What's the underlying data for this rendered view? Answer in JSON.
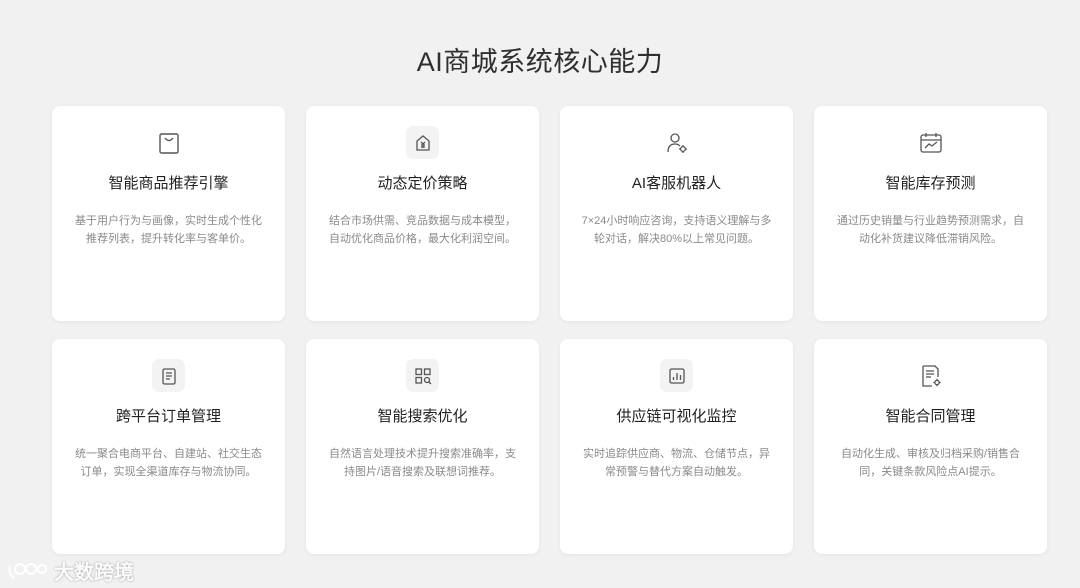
{
  "page": {
    "title": "AI商城系统核心能力"
  },
  "cards": [
    {
      "title": "智能商品推荐引擎",
      "desc": "基于用户行为与画像，实时生成个性化推荐列表，提升转化率与客单价。",
      "icon": "shopping-bag-icon"
    },
    {
      "title": "动态定价策略",
      "desc": "结合市场供需、竞品数据与成本模型，自动优化商品价格，最大化利润空间。",
      "icon": "price-tag-icon"
    },
    {
      "title": "AI客服机器人",
      "desc": "7×24小时响应咨询，支持语义理解与多轮对话，解决80%以上常见问题。",
      "icon": "user-gear-icon"
    },
    {
      "title": "智能库存预测",
      "desc": "通过历史销量与行业趋势预测需求，自动化补货建议降低滞销风险。",
      "icon": "calendar-chart-icon"
    },
    {
      "title": "跨平台订单管理",
      "desc": "统一聚合电商平台、自建站、社交生态订单，实现全渠道库存与物流协同。",
      "icon": "order-list-icon"
    },
    {
      "title": "智能搜索优化",
      "desc": "自然语言处理技术提升搜索准确率，支持图片/语音搜索及联想词推荐。",
      "icon": "grid-search-icon"
    },
    {
      "title": "供应链可视化监控",
      "desc": "实时追踪供应商、物流、仓储节点，异常预警与替代方案自动触发。",
      "icon": "bar-chart-icon"
    },
    {
      "title": "智能合同管理",
      "desc": "自动化生成、审核及归档采购/销售合同，关键条款风险点AI提示。",
      "icon": "document-gear-icon"
    }
  ],
  "watermark": {
    "text": "大数跨境"
  }
}
